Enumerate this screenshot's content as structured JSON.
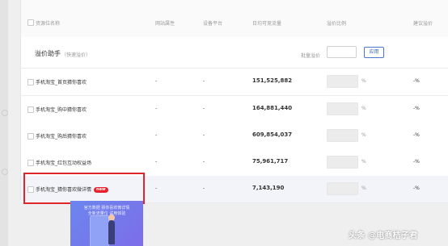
{
  "table": {
    "headers": {
      "name": "资源位名称",
      "attribute": "网站属性",
      "platform": "设备平台",
      "traffic": "日均可竞流量",
      "ratio": "溢价比例",
      "suggest": "建议溢价"
    },
    "rows": [
      {
        "name": "手机淘宝_首页猜你喜欢",
        "attribute": "-",
        "platform": "-",
        "traffic": "151,525,882",
        "percent": "%",
        "suggest": "-%"
      },
      {
        "name": "手机淘宝_购中猜你喜欢",
        "attribute": "-",
        "platform": "-",
        "traffic": "164,881,440",
        "percent": "%",
        "suggest": "-%"
      },
      {
        "name": "手机淘宝_购后猜你喜欢",
        "attribute": "-",
        "platform": "-",
        "traffic": "609,854,037",
        "percent": "%",
        "suggest": "-%"
      },
      {
        "name": "手机淘宝_红包互动权益场",
        "attribute": "-",
        "platform": "-",
        "traffic": "75,961,717",
        "percent": "%",
        "suggest": "-%"
      },
      {
        "name": "手机淘宝_猜你喜欢微详情",
        "badge": "new",
        "attribute": "-",
        "platform": "-",
        "traffic": "7,143,190",
        "percent": "%",
        "suggest": "-%"
      }
    ]
  },
  "assistant": {
    "title": "溢价助手",
    "hint": "（快速溢价）",
    "bulk_label": "批量溢价",
    "bulk_value": "",
    "apply_label": "应用"
  },
  "preview": {
    "line1": "官方数据 猜你喜欢微详情",
    "line2": "全新流量位 试用体验"
  },
  "watermark": "头条 @电商桔子君",
  "colors": {
    "highlight_border": "#e0262a",
    "badge_bg": "#e8202b",
    "apply_border": "#4a77c9"
  }
}
